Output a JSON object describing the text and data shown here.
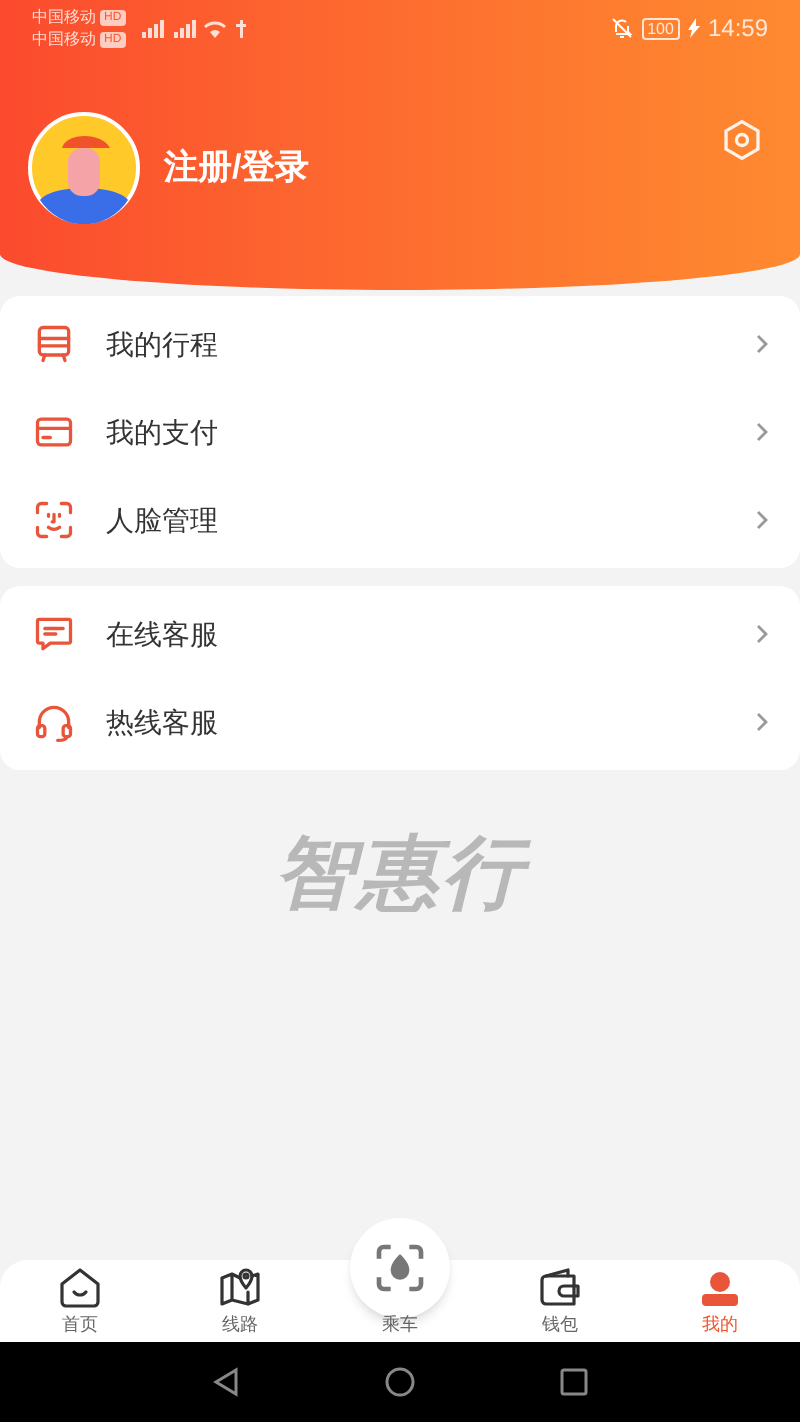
{
  "status_bar": {
    "carriers": [
      {
        "name": "中国移动",
        "badge": "HD"
      },
      {
        "name": "中国移动",
        "badge": "HD"
      }
    ],
    "battery": "100",
    "time": "14:59"
  },
  "profile": {
    "login_label": "注册/登录"
  },
  "menu_groups": [
    {
      "items": [
        {
          "kind": "trip",
          "label": "我的行程"
        },
        {
          "kind": "card",
          "label": "我的支付"
        },
        {
          "kind": "face",
          "label": "人脸管理"
        }
      ]
    },
    {
      "items": [
        {
          "kind": "chat",
          "label": "在线客服"
        },
        {
          "kind": "headset",
          "label": "热线客服"
        }
      ]
    }
  ],
  "brand_mark": "智惠行",
  "tabs": [
    {
      "kind": "home",
      "label": "首页",
      "selected": false
    },
    {
      "kind": "map",
      "label": "线路",
      "selected": false
    },
    {
      "kind": "scan",
      "label": "乘车",
      "selected": false
    },
    {
      "kind": "wallet",
      "label": "钱包",
      "selected": false
    },
    {
      "kind": "me",
      "label": "我的",
      "selected": true
    }
  ]
}
